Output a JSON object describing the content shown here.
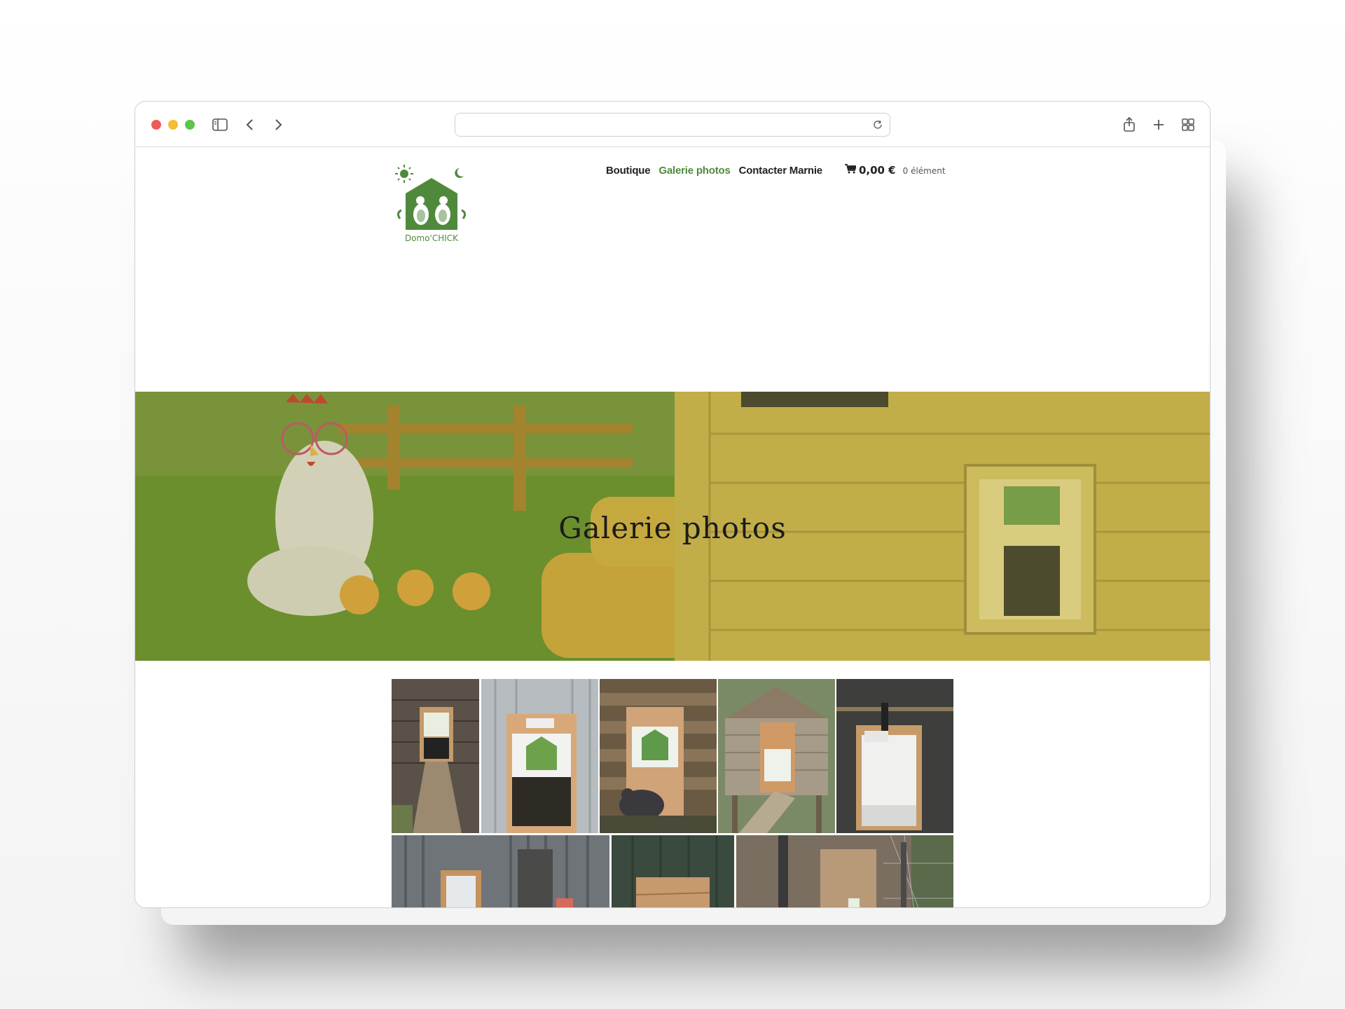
{
  "browser": {
    "address_value": "",
    "icons": [
      "sidebar-icon",
      "back-icon",
      "forward-icon",
      "reload-icon",
      "share-icon",
      "new-tab-icon",
      "tabs-overview-icon"
    ]
  },
  "site": {
    "logo_text": "Domo'CHICK",
    "nav": [
      {
        "label": "Boutique",
        "active": false
      },
      {
        "label": "Galerie photos",
        "active": true
      },
      {
        "label": "Contacter Marnie",
        "active": false
      }
    ],
    "cart": {
      "amount": "0,00 €",
      "count": "0 élément"
    },
    "accent_color": "#4f8a3c"
  },
  "hero": {
    "title": "Galerie photos"
  },
  "gallery": {
    "photos": [
      {
        "name": "photo-wooden-door-ramp"
      },
      {
        "name": "photo-door-metal-wall"
      },
      {
        "name": "photo-door-pallet-hen"
      },
      {
        "name": "photo-coop-house"
      },
      {
        "name": "photo-door-dark-shed"
      },
      {
        "name": "photo-door-corrugated-feeder"
      },
      {
        "name": "photo-wooden-box-green-wall"
      },
      {
        "name": "photo-coop-enclosure"
      }
    ]
  }
}
